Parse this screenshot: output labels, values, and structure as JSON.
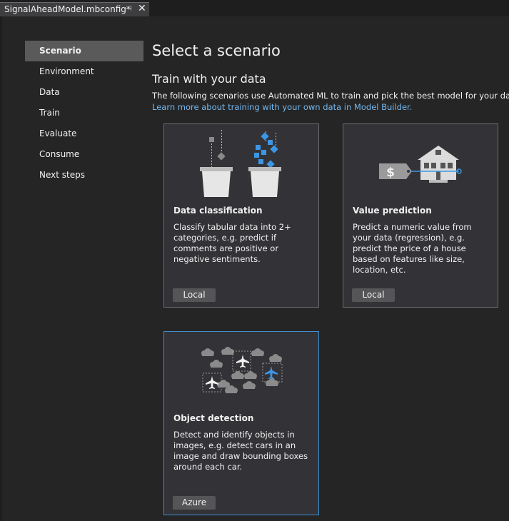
{
  "tab": {
    "title": "SignalAheadModel.mbconfig*"
  },
  "nav": {
    "items": [
      {
        "label": "Scenario"
      },
      {
        "label": "Environment"
      },
      {
        "label": "Data"
      },
      {
        "label": "Train"
      },
      {
        "label": "Evaluate"
      },
      {
        "label": "Consume"
      },
      {
        "label": "Next steps"
      }
    ]
  },
  "main": {
    "title": "Select a scenario",
    "subtitle": "Train with your data",
    "description": "The following scenarios use Automated ML to train and pick the best model for your data.",
    "learn_more": "Learn more about training with your own data in Model Builder."
  },
  "cards": [
    {
      "title": "Data classification",
      "description": "Classify tabular data into 2+ categories, e.g. predict if comments are positive or negative sentiments.",
      "button": "Local",
      "icon": "buckets-classification-icon"
    },
    {
      "title": "Value prediction",
      "description": "Predict a numeric value from your data (regression), e.g. predict the price of a house based on features like size, location, etc.",
      "button": "Local",
      "icon": "house-price-icon"
    },
    {
      "title": "Object detection",
      "description": "Detect and identify objects in images, e.g. detect cars in an image and draw bounding boxes around each car.",
      "button": "Azure",
      "icon": "planes-clouds-icon"
    }
  ],
  "colors": {
    "accent": "#3e8ed0",
    "link": "#74b8ef",
    "icon_blue": "#3c96e6"
  }
}
